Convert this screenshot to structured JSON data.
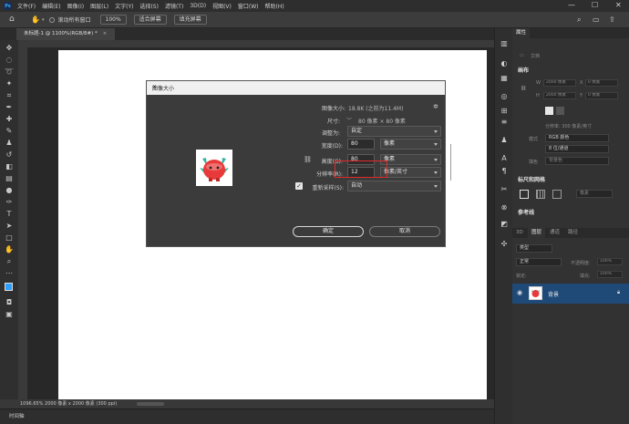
{
  "app": {
    "logo_text": "Ps",
    "menus": [
      "文件(F)",
      "编辑(E)",
      "图像(I)",
      "图层(L)",
      "文字(Y)",
      "选择(S)",
      "滤镜(T)",
      "3D(D)",
      "视图(V)",
      "窗口(W)",
      "帮助(H)"
    ],
    "window_controls": {
      "minimize": "—",
      "maximize": "☐",
      "close": "✕"
    }
  },
  "options_bar": {
    "scroll_all": "滚动所有窗口",
    "zoom": "100%",
    "fit_screen": "适合屏幕",
    "fill_screen": "填充屏幕"
  },
  "document_tab": {
    "title": "未标题-1 @ 1100%(RGB/8#) *",
    "close": "×"
  },
  "status_bar": {
    "text": "1096.65%  2000 像素 x 2000 像素 (300 ppi)"
  },
  "timeline": {
    "label": "时间轴"
  },
  "right_panel": {
    "properties_tab": "属性",
    "doc_label": "文档",
    "canvas_section": "画布",
    "w_label": "W",
    "w_value": "2000 像素",
    "x_label": "X",
    "x_value": "0 像素",
    "h_label": "H",
    "h_value": "2000 像素",
    "y_label": "Y",
    "y_value": "0 像素",
    "resolution": "分辨率: 300 像素/英寸",
    "mode_label": "模式",
    "mode_value": "RGB 颜色",
    "depth_value": "8 位/通道",
    "fill_label": "填色",
    "fill_value": "背景色",
    "rulers_section": "标尺和网格",
    "unit_value": "像素",
    "guides_section": "参考线",
    "layer_tabs": [
      "3D",
      "图层",
      "通道",
      "路径"
    ],
    "kind_filter": "类型",
    "blend_mode": "正常",
    "opacity_label": "不透明度:",
    "opacity_value": "100%",
    "lock_label": "锁定:",
    "fill_opacity_label": "填充:",
    "fill_opacity_value": "100%",
    "layer_name": "背景"
  },
  "dialog": {
    "title": "图像大小",
    "close": "✕",
    "image_size_label": "图像大小:",
    "image_size_value": "18.8K (之前为11.4M)",
    "dimensions_label": "尺寸:",
    "dimensions_value": "80 像素 × 80 像素",
    "fit_label": "调整为:",
    "fit_value": "自定",
    "width_label": "宽度(D):",
    "width_value": "80",
    "width_unit": "像素",
    "height_label": "高度(G):",
    "height_value": "80",
    "height_unit": "像素",
    "resolution_label": "分辨率(R):",
    "resolution_value": "12",
    "resolution_unit": "像素/英寸",
    "resample_label": "重新采样(S):",
    "resample_checked": true,
    "resample_value": "自动",
    "ok": "确定",
    "cancel": "取消"
  },
  "colors": {
    "menubar": "#2e2e2e",
    "canvas_bg": "#282828",
    "dialog_bg": "#3b3b3b",
    "highlight": "#e02a2a",
    "layer_selected": "#1f4a78",
    "foreground": "#2ea0ff"
  }
}
